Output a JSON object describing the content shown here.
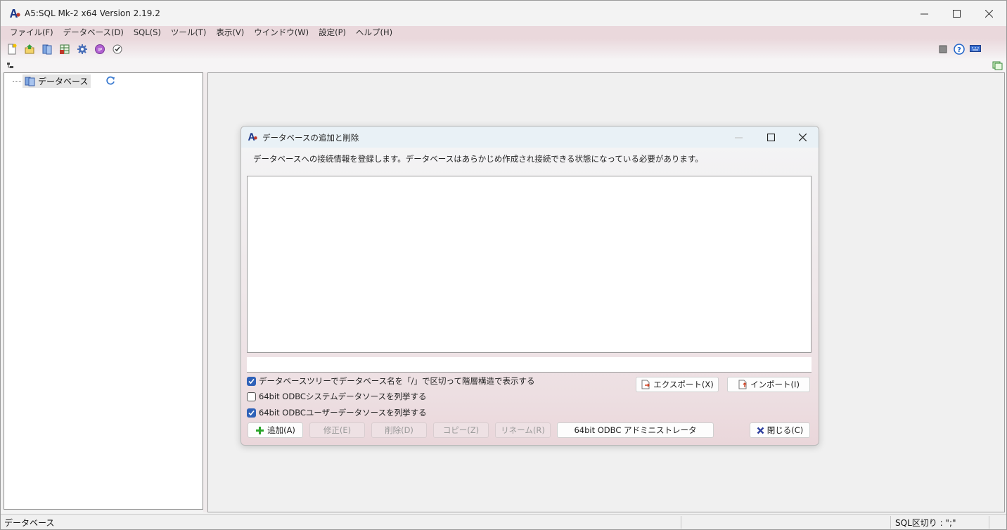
{
  "window": {
    "title": "A5:SQL Mk-2 x64 Version 2.19.2"
  },
  "menu": {
    "items": [
      "ファイル(F)",
      "データベース(D)",
      "SQL(S)",
      "ツール(T)",
      "表示(V)",
      "ウインドウ(W)",
      "設定(P)",
      "ヘルプ(H)"
    ]
  },
  "toolbar": {
    "icons": [
      "new-file-icon",
      "open-icon",
      "database-icon",
      "table-icon",
      "gear-icon",
      "plugin-icon",
      "check-icon"
    ],
    "right_icons": [
      "stop-icon",
      "help-icon",
      "keyboard-icon"
    ]
  },
  "tree": {
    "root_label": "データベース"
  },
  "status": {
    "left": "データベース",
    "right": "SQL区切り : \";\""
  },
  "dialog": {
    "title": "データベースの追加と削除",
    "description": "データベースへの接続情報を登録します。データベースはあらかじめ作成され接続できる状態になっている必要があります。",
    "checkboxes": [
      {
        "label": "データベースツリーでデータベース名を「/」で区切って階層構造で表示する",
        "checked": true
      },
      {
        "label": "64bit ODBCシステムデータソースを列挙する",
        "checked": false
      },
      {
        "label": "64bit ODBCユーザーデータソースを列挙する",
        "checked": true
      }
    ],
    "buttons": {
      "export": "エクスポート(X)",
      "import": "インポート(I)",
      "add": "追加(A)",
      "edit": "修正(E)",
      "delete": "削除(D)",
      "copy": "コピー(Z)",
      "rename": "リネーム(R)",
      "odbc_admin": "64bit ODBC アドミニストレータ",
      "close": "閉じる(C)"
    }
  },
  "colors": {
    "menu_bg": "#ead8dc",
    "checkbox_on": "#2f62b8",
    "add_icon": "#2aa52a",
    "close_icon": "#2a3c9c"
  }
}
